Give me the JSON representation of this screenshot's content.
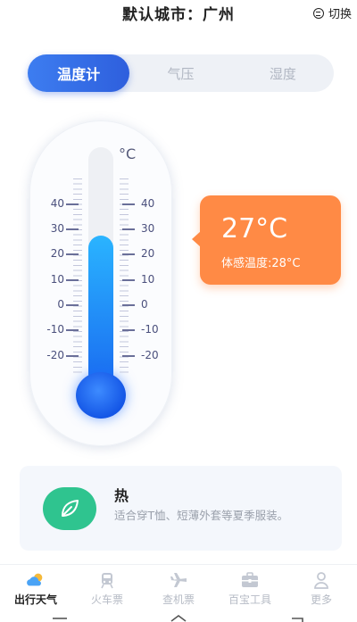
{
  "header": {
    "city_label": "默认城市：广州",
    "switch_label": "切换"
  },
  "tabs": [
    {
      "label": "温度计",
      "active": true
    },
    {
      "label": "气压",
      "active": false
    },
    {
      "label": "湿度",
      "active": false
    }
  ],
  "thermometer": {
    "unit": "°C",
    "scale_labels": [
      "40",
      "30",
      "20",
      "10",
      "0",
      "-10",
      "-20"
    ],
    "mercury_level_c": 27,
    "mercury_color": "#1a8cff"
  },
  "reading": {
    "temperature": "27°C",
    "feels_like": "体感温度:28°C",
    "bubble_color": "#ff8a45"
  },
  "advice": {
    "title": "热",
    "text": "适合穿T恤、短薄外套等夏季服装。",
    "icon": "leaf-icon",
    "icon_color": "#2fc48f"
  },
  "tabbar": [
    {
      "label": "出行天气",
      "icon": "weather-icon",
      "active": true
    },
    {
      "label": "火车票",
      "icon": "train-icon",
      "active": false
    },
    {
      "label": "查机票",
      "icon": "airplane-icon",
      "active": false
    },
    {
      "label": "百宝工具",
      "icon": "toolbox-icon",
      "active": false
    },
    {
      "label": "更多",
      "icon": "user-icon",
      "active": false
    }
  ],
  "system_nav": [
    "menu-icon",
    "home-icon",
    "back-icon"
  ],
  "colors": {
    "accent": "#2e5fdd",
    "inactive_text": "#b6bbc5"
  }
}
